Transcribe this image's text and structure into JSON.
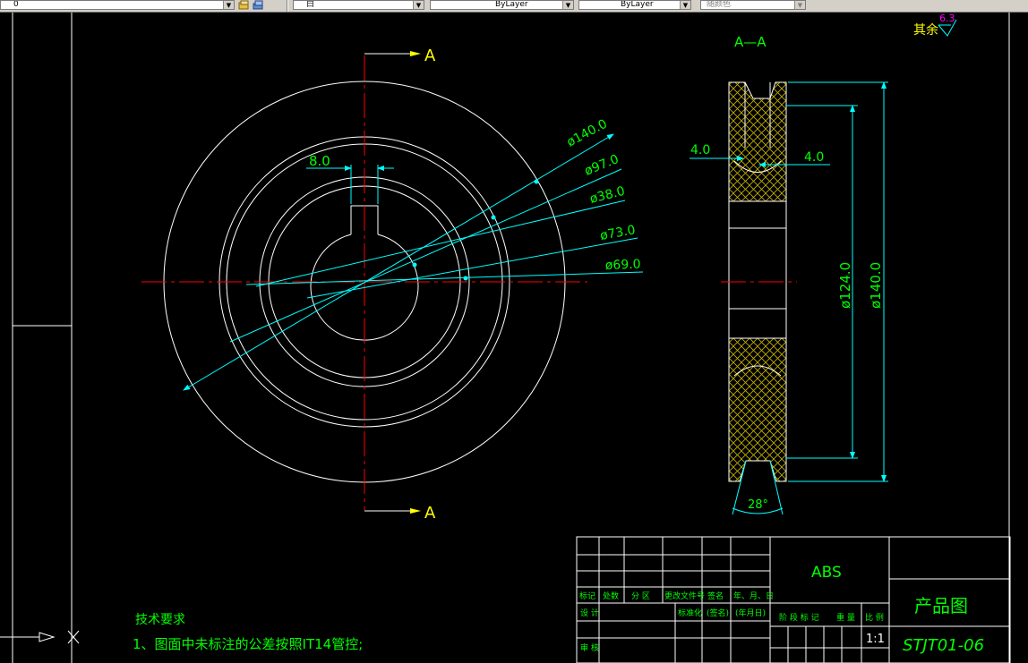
{
  "toolbar": {
    "layer_value": "0",
    "color_value": "白",
    "linetype_value": "ByLayer",
    "lineweight_value": "ByLayer",
    "plotstyle_value": "随颜色"
  },
  "drawing": {
    "section_label_top": "A",
    "section_label_bottom": "A",
    "section_title": "A—A",
    "roughness_label": "其余",
    "roughness_value": "6.3",
    "dim_keyway": "8.0",
    "dim_d140": "ø140.0",
    "dim_d97": "ø97.0",
    "dim_d38": "ø38.0",
    "dim_d73": "ø73.0",
    "dim_d69": "ø69.0",
    "dim_left_4": "4.0",
    "dim_right_4": "4.0",
    "dim_v124": "ø124.0",
    "dim_v140": "ø140.0",
    "dim_angle": "28°"
  },
  "notes": {
    "title": "技术要求",
    "line1": "1、图面中未标注的公差按照IT14管控;"
  },
  "title_block": {
    "material": "ABS",
    "drawing_name": "产品图",
    "drawing_number": "STJT01-06",
    "scale": "1:1",
    "h_mark": "标记",
    "h_count": "处数",
    "h_zone": "分 区",
    "h_doc": "更改文件号",
    "h_sign": "签名",
    "h_date": "年、月、日",
    "h_design": "设 计",
    "h_std": "标准化",
    "h_sign2": "(签名)",
    "h_date2": "(年月日)",
    "h_stage": "阶 段 标 记",
    "h_weight": "重 量",
    "h_ratio": "比 例",
    "h_review": "审 核"
  },
  "colors": {
    "background": "#000000",
    "geometry": "#ffffff",
    "dimension": "#00ffff",
    "text": "#00ff00",
    "center": "#ff0000",
    "section_arrow": "#ffff00",
    "hatch": "#ffff00",
    "roughness": "#ff00ff"
  }
}
